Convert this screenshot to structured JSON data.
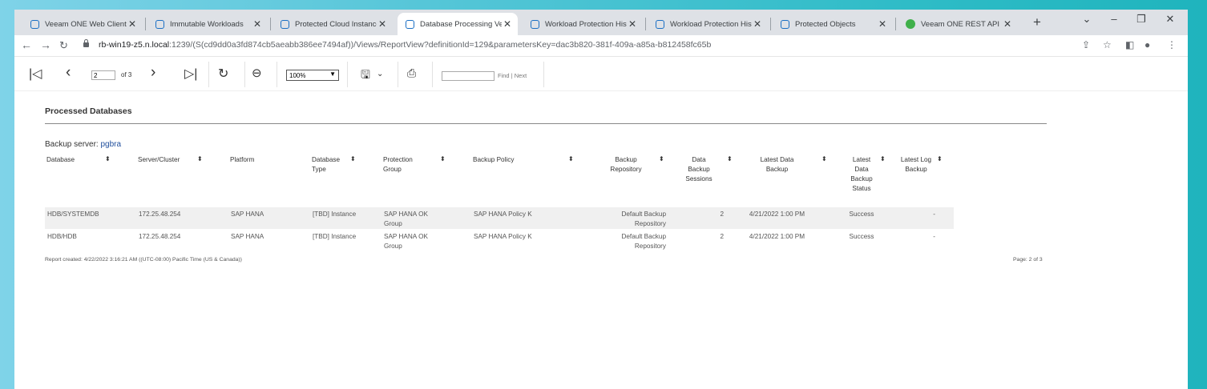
{
  "tabs": [
    {
      "title": "Veeam ONE Web Client",
      "active": false
    },
    {
      "title": "Immutable Workloads",
      "active": false
    },
    {
      "title": "Protected Cloud Instances",
      "active": false
    },
    {
      "title": "Database Processing Verifi",
      "active": true
    },
    {
      "title": "Workload Protection Histo",
      "active": false
    },
    {
      "title": "Workload Protection Histo",
      "active": false
    },
    {
      "title": "Protected Objects",
      "active": false
    },
    {
      "title": "Veeam ONE REST API",
      "active": false
    }
  ],
  "address": {
    "host": "rb-win19-z5.n.local",
    "path": ":1239/(S(cd9dd0a3fd874cb5aeabb386ee7494af))/Views/ReportView?definitionId=129&parametersKey=dac3b820-381f-409a-a85a-b812458fc65b"
  },
  "toolbar": {
    "page_value": "2",
    "of_pages": "of 3",
    "zoom": "100%",
    "find_label": "Find",
    "next_label": "Next",
    "find_sep": "|"
  },
  "report": {
    "title": "Processed Databases",
    "backup_server_label": "Backup server:",
    "backup_server_value": "pgbra",
    "columns": [
      [
        "Database"
      ],
      [
        "Server/Cluster"
      ],
      [
        "Platform"
      ],
      [
        "Database",
        "Type"
      ],
      [
        "Protection",
        "Group"
      ],
      [
        "Backup Policy"
      ],
      [
        "Backup",
        "Repository"
      ],
      [
        "Data",
        "Backup",
        "Sessions"
      ],
      [
        "Latest Data",
        "Backup"
      ],
      [
        "Latest",
        "Data",
        "Backup",
        "Status"
      ],
      [
        "Latest Log",
        "Backup"
      ]
    ],
    "rows": [
      [
        [
          "HDB/SYSTEMDB"
        ],
        [
          "172.25.48.254"
        ],
        [
          "SAP HANA"
        ],
        [
          "[TBD] Instance"
        ],
        [
          "SAP HANA OK",
          "Group"
        ],
        [
          "SAP HANA Policy K"
        ],
        [
          "Default Backup",
          "Repository"
        ],
        [
          "2"
        ],
        [
          "4/21/2022 1:00 PM"
        ],
        [
          "Success"
        ],
        [
          "-"
        ]
      ],
      [
        [
          "HDB/HDB"
        ],
        [
          "172.25.48.254"
        ],
        [
          "SAP HANA"
        ],
        [
          "[TBD] Instance"
        ],
        [
          "SAP HANA OK",
          "Group"
        ],
        [
          "SAP HANA Policy K"
        ],
        [
          "Default Backup",
          "Repository"
        ],
        [
          "2"
        ],
        [
          "4/21/2022 1:00 PM"
        ],
        [
          "Success"
        ],
        [
          "-"
        ]
      ]
    ],
    "footer_created": "Report created: 4/22/2022 3:16:21 AM ((UTC-08:00) Pacific Time (US & Canada))",
    "footer_page": "Page: 2 of 3"
  }
}
